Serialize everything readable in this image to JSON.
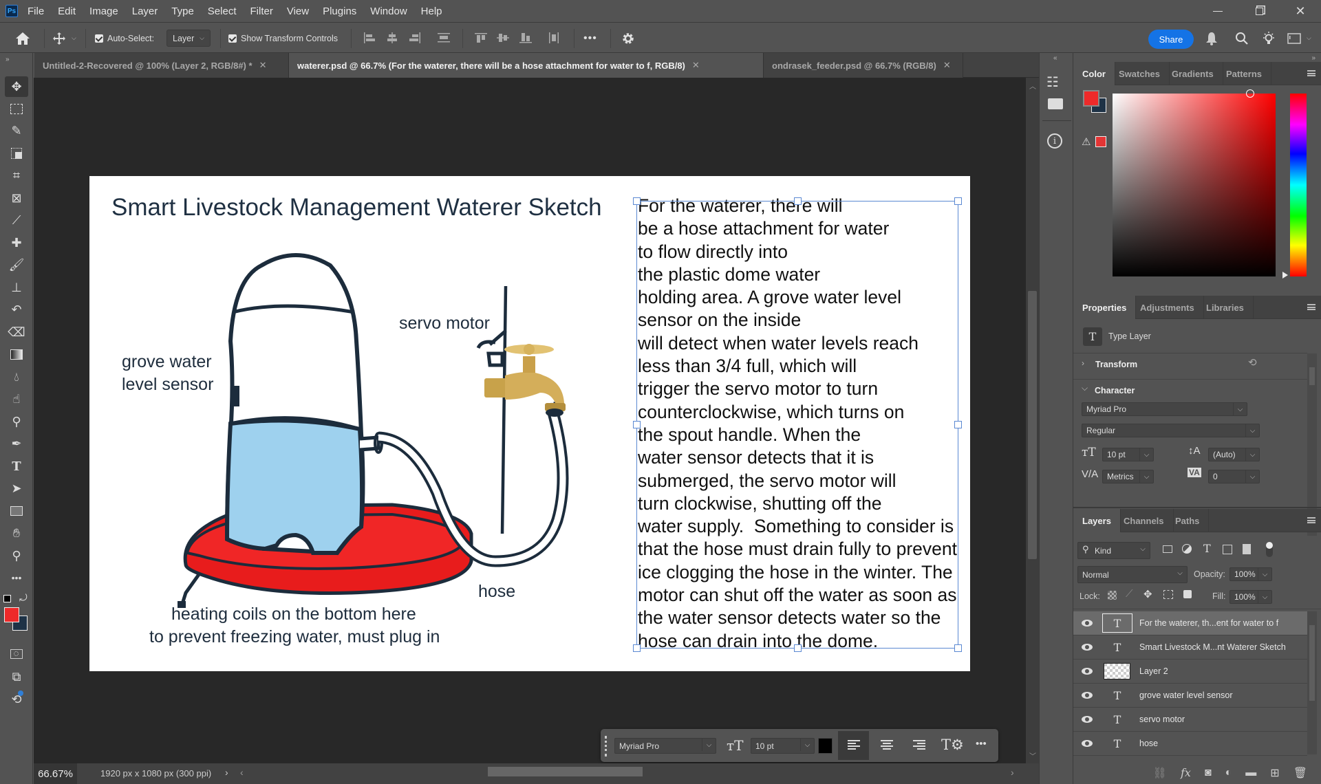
{
  "app": {
    "logo": "Ps",
    "menu": [
      "File",
      "Edit",
      "Image",
      "Layer",
      "Type",
      "Select",
      "Filter",
      "View",
      "Plugins",
      "Window",
      "Help"
    ],
    "window_controls": {
      "minimize": "minimize-icon",
      "restore": "restore-icon",
      "close": "close-icon"
    }
  },
  "options_bar": {
    "auto_select_label": "Auto-Select:",
    "auto_select_checked": true,
    "auto_select_target": "Layer",
    "show_transform_label": "Show Transform Controls",
    "show_transform_checked": true,
    "more": "•••",
    "share_label": "Share"
  },
  "tabs": [
    {
      "label": "Untitled-2-Recovered @ 100% (Layer 2, RGB/8#) *",
      "active": false
    },
    {
      "label": "waterer.psd @ 66.7% (For the waterer, there will be a hose attachment for water to f, RGB/8)",
      "active": true
    },
    {
      "label": "ondrasek_feeder.psd @ 66.7% (RGB/8)",
      "active": false
    }
  ],
  "tools": [
    "move",
    "rectangular-marquee",
    "quick-selection",
    "object-selection",
    "crop",
    "frame",
    "eyedropper",
    "spot-healing",
    "brush",
    "clone-stamp",
    "history-brush",
    "eraser",
    "gradient",
    "blur",
    "smudge",
    "dodge",
    "pen",
    "type",
    "path-selection",
    "rectangle",
    "hand",
    "zoom",
    "more-tools"
  ],
  "colors": {
    "foreground": "#ee2a2a",
    "background": "#1e3246",
    "accent": "#1473e6",
    "selection_box": "#5a88d2"
  },
  "document": {
    "title": "Smart Livestock Management Waterer Sketch",
    "labels": {
      "sensor_line1": "grove water",
      "sensor_line2": "level sensor",
      "servo": "servo motor",
      "hose": "hose",
      "heating_line1": "heating coils on the bottom here",
      "heating_line2": "to prevent freezing water, must plug in"
    },
    "body_lines": [
      "For the waterer, there will",
      "be a hose attachment for water",
      "to flow directly into",
      "the plastic dome water",
      "holding area. A grove water level",
      "sensor on the inside",
      "will detect when water levels reach",
      "less than 3/4 full, which will",
      "trigger the servo motor to turn",
      "counterclockwise, which turns on",
      "the spout handle. When the",
      "water sensor detects that it is",
      "submerged, the servo motor will",
      "turn clockwise, shutting off the",
      "water supply.  Something to consider is",
      "that the hose must drain fully to prevent",
      "ice clogging the hose in the winter. The",
      "motor can shut off the water as soon as",
      "the water sensor detects water so the",
      "hose can drain into the dome."
    ]
  },
  "status": {
    "zoom": "66.67%",
    "doc_info": "1920 px x 1080 px (300 ppi)"
  },
  "color_panel": {
    "tabs": [
      "Color",
      "Swatches",
      "Gradients",
      "Patterns"
    ],
    "active_tab": "Color"
  },
  "properties_panel": {
    "tabs": [
      "Properties",
      "Adjustments",
      "Libraries"
    ],
    "active_tab": "Properties",
    "layer_type": "Type Layer",
    "transform_label": "Transform",
    "character_label": "Character",
    "font_family": "Myriad Pro",
    "font_style": "Regular",
    "font_size": "10 pt",
    "leading": "(Auto)",
    "kerning": "Metrics",
    "tracking": "0"
  },
  "layers_panel": {
    "tabs": [
      "Layers",
      "Channels",
      "Paths"
    ],
    "active_tab": "Layers",
    "filter_kind": "Kind",
    "blend_mode": "Normal",
    "opacity_label": "Opacity:",
    "opacity": "100%",
    "lock_label": "Lock:",
    "fill_label": "Fill:",
    "fill": "100%",
    "layers": [
      {
        "name": "For the waterer, th...ent for water to f",
        "kind": "type",
        "selected": true,
        "visible": true
      },
      {
        "name": "Smart Livestock M...nt Waterer Sketch",
        "kind": "type",
        "selected": false,
        "visible": true
      },
      {
        "name": "Layer 2",
        "kind": "pixel",
        "selected": false,
        "visible": true
      },
      {
        "name": "grove water level sensor",
        "kind": "type",
        "selected": false,
        "visible": true
      },
      {
        "name": "servo motor",
        "kind": "type",
        "selected": false,
        "visible": true
      },
      {
        "name": "hose",
        "kind": "type",
        "selected": false,
        "visible": true
      }
    ]
  },
  "context_bar": {
    "font_family": "Myriad Pro",
    "font_size": "10 pt",
    "text_color": "#000000",
    "align_active": "left",
    "more": "•••"
  }
}
